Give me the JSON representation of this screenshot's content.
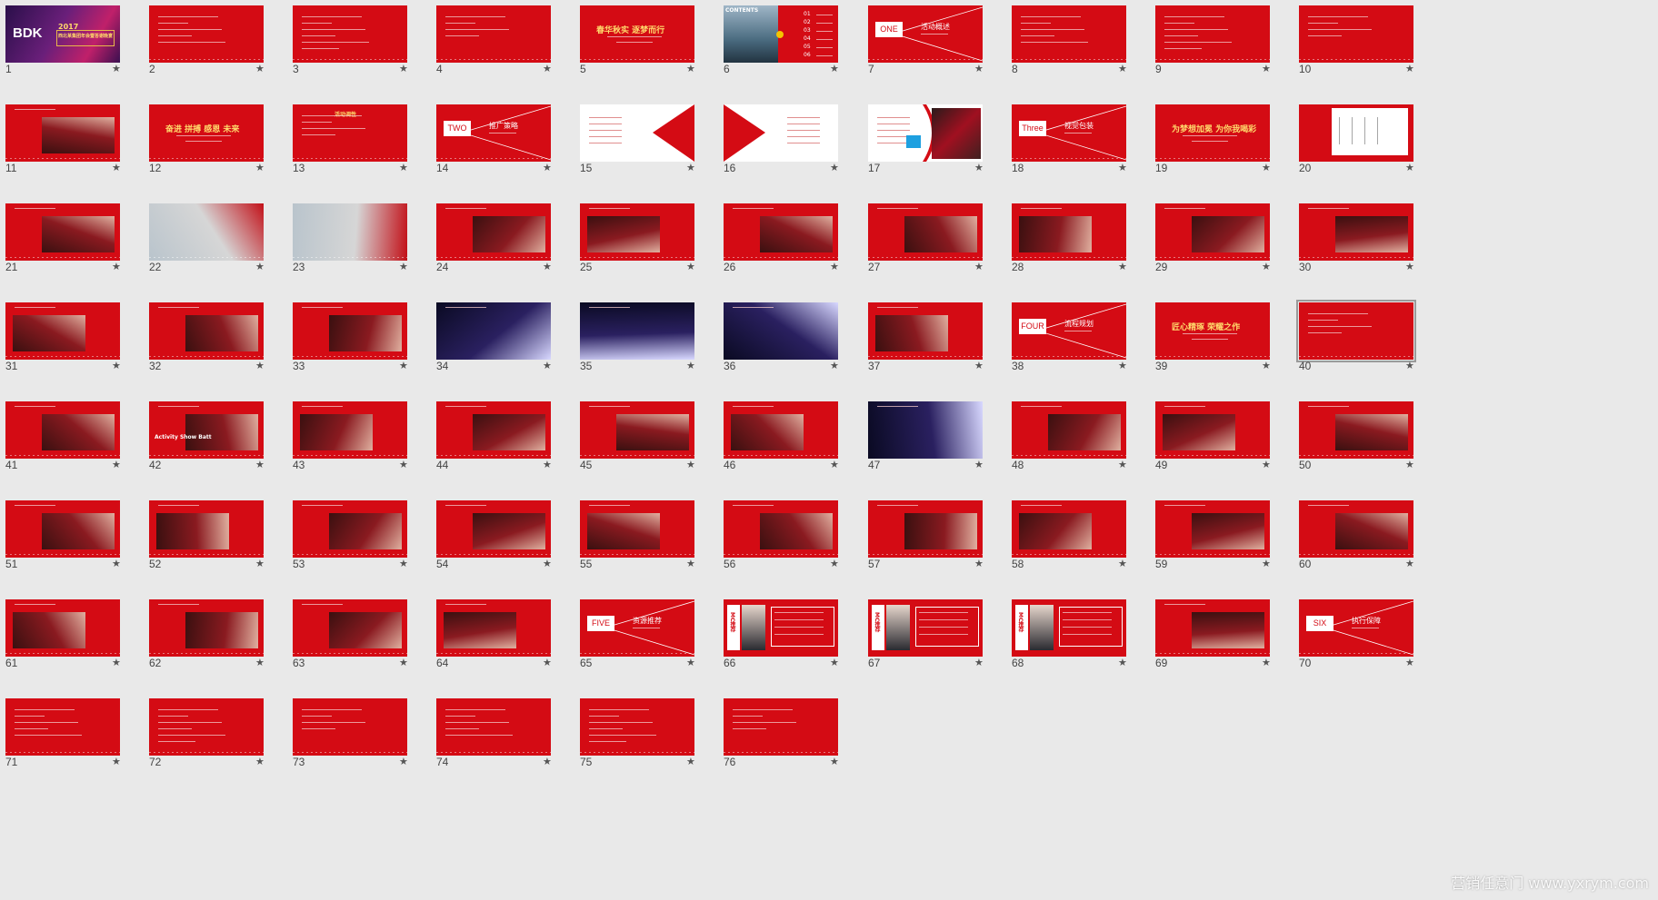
{
  "slides": [
    {
      "n": "1",
      "kind": "cover",
      "title": "BDK",
      "subtitle": "2017",
      "sub2": "西北某集团年会暨答谢晚宴"
    },
    {
      "n": "2",
      "kind": "text"
    },
    {
      "n": "3",
      "kind": "text"
    },
    {
      "n": "4",
      "kind": "text"
    },
    {
      "n": "5",
      "kind": "title",
      "title": "春华秋实 逐梦而行"
    },
    {
      "n": "6",
      "kind": "contents",
      "title": "CONTENTS",
      "items": [
        "01",
        "02",
        "03",
        "04",
        "05",
        "06"
      ]
    },
    {
      "n": "7",
      "kind": "section",
      "word": "ONE",
      "label": "活动概述"
    },
    {
      "n": "8",
      "kind": "text"
    },
    {
      "n": "9",
      "kind": "text"
    },
    {
      "n": "10",
      "kind": "text"
    },
    {
      "n": "11",
      "kind": "photo"
    },
    {
      "n": "12",
      "kind": "title",
      "title": "奋进 拼搏 感恩 未来"
    },
    {
      "n": "13",
      "kind": "text",
      "title": "活动调性"
    },
    {
      "n": "14",
      "kind": "section",
      "word": "TWO",
      "label": "推广策略"
    },
    {
      "n": "15",
      "kind": "white"
    },
    {
      "n": "16",
      "kind": "white"
    },
    {
      "n": "17",
      "kind": "white"
    },
    {
      "n": "18",
      "kind": "section",
      "word": "Three",
      "label": "视觉包装"
    },
    {
      "n": "19",
      "kind": "title",
      "title": "为梦想加冕 为你我喝彩"
    },
    {
      "n": "20",
      "kind": "plan"
    },
    {
      "n": "21",
      "kind": "photo"
    },
    {
      "n": "22",
      "kind": "render"
    },
    {
      "n": "23",
      "kind": "render"
    },
    {
      "n": "24",
      "kind": "photo"
    },
    {
      "n": "25",
      "kind": "photo"
    },
    {
      "n": "26",
      "kind": "photo"
    },
    {
      "n": "27",
      "kind": "photo"
    },
    {
      "n": "28",
      "kind": "photo"
    },
    {
      "n": "29",
      "kind": "photo"
    },
    {
      "n": "30",
      "kind": "photo"
    },
    {
      "n": "31",
      "kind": "photo"
    },
    {
      "n": "32",
      "kind": "photo"
    },
    {
      "n": "33",
      "kind": "photo"
    },
    {
      "n": "34",
      "kind": "stage"
    },
    {
      "n": "35",
      "kind": "stage"
    },
    {
      "n": "36",
      "kind": "stage"
    },
    {
      "n": "37",
      "kind": "photo"
    },
    {
      "n": "38",
      "kind": "section",
      "word": "FOUR",
      "label": "流程规划"
    },
    {
      "n": "39",
      "kind": "title",
      "title": "匠心精琢 荣耀之作"
    },
    {
      "n": "40",
      "kind": "text",
      "selected": true
    },
    {
      "n": "41",
      "kind": "photo"
    },
    {
      "n": "42",
      "kind": "photo",
      "title": "Activity Show Batt"
    },
    {
      "n": "43",
      "kind": "photo"
    },
    {
      "n": "44",
      "kind": "photo"
    },
    {
      "n": "45",
      "kind": "photo"
    },
    {
      "n": "46",
      "kind": "photo"
    },
    {
      "n": "47",
      "kind": "stage"
    },
    {
      "n": "48",
      "kind": "photo"
    },
    {
      "n": "49",
      "kind": "photo"
    },
    {
      "n": "50",
      "kind": "photo"
    },
    {
      "n": "51",
      "kind": "photo"
    },
    {
      "n": "52",
      "kind": "photo"
    },
    {
      "n": "53",
      "kind": "photo"
    },
    {
      "n": "54",
      "kind": "photo"
    },
    {
      "n": "55",
      "kind": "photo"
    },
    {
      "n": "56",
      "kind": "photo"
    },
    {
      "n": "57",
      "kind": "photo"
    },
    {
      "n": "58",
      "kind": "photo"
    },
    {
      "n": "59",
      "kind": "photo"
    },
    {
      "n": "60",
      "kind": "photo"
    },
    {
      "n": "61",
      "kind": "photo"
    },
    {
      "n": "62",
      "kind": "photo"
    },
    {
      "n": "63",
      "kind": "photo"
    },
    {
      "n": "64",
      "kind": "photo"
    },
    {
      "n": "65",
      "kind": "section",
      "word": "FIVE",
      "label": "资源推荐"
    },
    {
      "n": "66",
      "kind": "mc",
      "label": "MC推荐"
    },
    {
      "n": "67",
      "kind": "mc",
      "label": "MC推荐"
    },
    {
      "n": "68",
      "kind": "mc",
      "label": "MC推荐"
    },
    {
      "n": "69",
      "kind": "photo"
    },
    {
      "n": "70",
      "kind": "section",
      "word": "SIX",
      "label": "执行保障"
    },
    {
      "n": "71",
      "kind": "text"
    },
    {
      "n": "72",
      "kind": "text"
    },
    {
      "n": "73",
      "kind": "text"
    },
    {
      "n": "74",
      "kind": "text"
    },
    {
      "n": "75",
      "kind": "text"
    },
    {
      "n": "76",
      "kind": "text"
    }
  ],
  "star": "★",
  "watermark": "营销任意门 www.yxrym.com",
  "colors": {
    "slide_red": "#d40b14",
    "background": "#e9e9e9",
    "title_gold": "#ffd96b"
  }
}
